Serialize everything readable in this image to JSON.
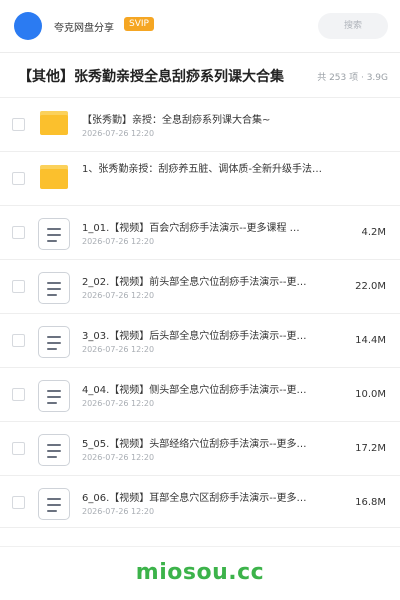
{
  "header": {
    "app_name": "夸克网盘分享",
    "badge": "SVIP",
    "search_placeholder": "搜索"
  },
  "title": {
    "text": "【其他】张秀勤亲授全息刮痧系列课大合集",
    "meta": "共 253 项 · 3.9G"
  },
  "files": [
    {
      "type": "folder",
      "name": "【张秀勤】亲授：全息刮痧系列课大合集~",
      "date": "2026-07-26 12:20",
      "size": ""
    },
    {
      "type": "folder",
      "name": "1、张秀勤亲授：刮痧养五脏、调体质-全新升级手法…",
      "date": "2026-07-26 12:20",
      "size": ""
    },
    {
      "type": "file",
      "name": "1_01.【视频】百会穴刮痧手法演示--更多课程 …",
      "date": "2026-07-26 12:20",
      "size": "4.2M"
    },
    {
      "type": "file",
      "name": "2_02.【视频】前头部全息穴位刮痧手法演示--更…",
      "date": "2026-07-26 12:20",
      "size": "22.0M"
    },
    {
      "type": "file",
      "name": "3_03.【视频】后头部全息穴位刮痧手法演示--更…",
      "date": "2026-07-26 12:20",
      "size": "14.4M"
    },
    {
      "type": "file",
      "name": "4_04.【视频】侧头部全息穴位刮痧手法演示--更…",
      "date": "2026-07-26 12:20",
      "size": "10.0M"
    },
    {
      "type": "file",
      "name": "5_05.【视频】头部经络穴位刮痧手法演示--更多…",
      "date": "2026-07-26 12:20",
      "size": "17.2M"
    },
    {
      "type": "file",
      "name": "6_06.【视频】耳部全息穴区刮痧手法演示--更多…",
      "date": "2026-07-26 12:20",
      "size": "16.8M"
    }
  ],
  "footer": {
    "text": "miosou.cc"
  },
  "colors": {
    "accent": "#2b7bf2",
    "badge": "#f5a623",
    "folder": "#fbc02d",
    "footer": "#3cb34a"
  }
}
